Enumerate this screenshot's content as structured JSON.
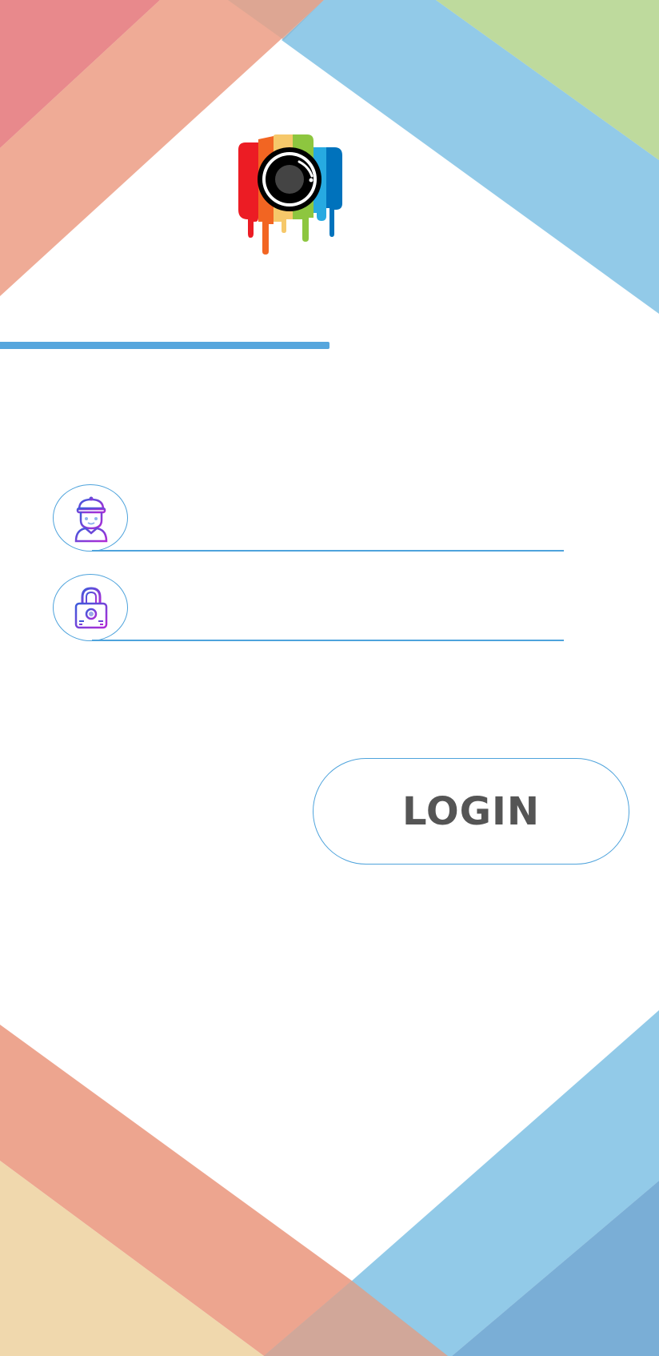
{
  "login_form": {
    "username": {
      "icon": "user-icon",
      "value": "",
      "placeholder": ""
    },
    "password": {
      "icon": "lock-icon",
      "value": "",
      "placeholder": ""
    },
    "login_label": "LOGIN"
  },
  "theme": {
    "accent": "#4ea3dc",
    "button_text": "#555555",
    "logo_stripes": [
      "#ec1c24",
      "#f26522",
      "#f6c86a",
      "#8dc63f",
      "#27aae1",
      "#0072bc"
    ]
  }
}
